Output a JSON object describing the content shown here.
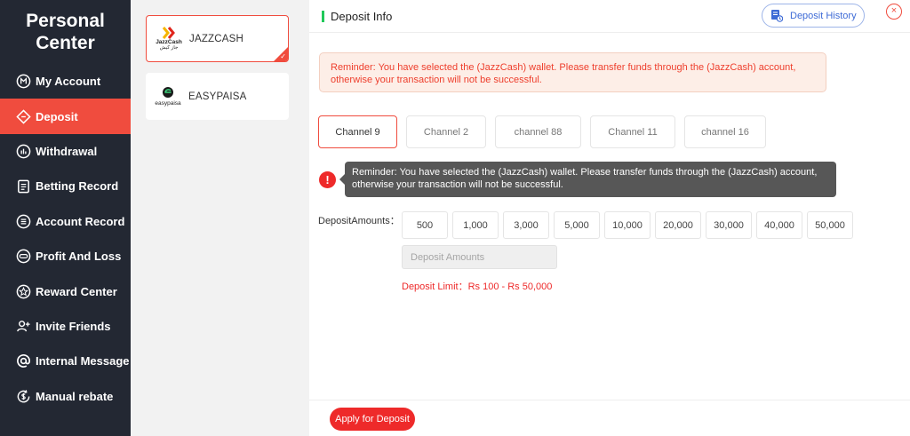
{
  "sidebar": {
    "title_line1": "Personal",
    "title_line2": "Center",
    "items": [
      {
        "label": "My Account",
        "icon": "account-circle-icon",
        "active": false
      },
      {
        "label": "Deposit",
        "icon": "ticket-icon",
        "active": true
      },
      {
        "label": "Withdrawal",
        "icon": "bar-chart-circle-icon",
        "active": false
      },
      {
        "label": "Betting Record",
        "icon": "clipboard-icon",
        "active": false
      },
      {
        "label": "Account Record",
        "icon": "list-document-icon",
        "active": false
      },
      {
        "label": "Profit And Loss",
        "icon": "dots-circle-icon",
        "active": false
      },
      {
        "label": "Reward Center",
        "icon": "star-badge-icon",
        "active": false
      },
      {
        "label": "Invite Friends",
        "icon": "add-user-icon",
        "active": false
      },
      {
        "label": "Internal Message",
        "icon": "at-sign-icon",
        "active": false
      },
      {
        "label": "Manual rebate",
        "icon": "dollar-refresh-icon",
        "active": false
      }
    ],
    "active_color": "#f04c3e"
  },
  "wallets": [
    {
      "name": "JAZZCASH",
      "logo_text": "JazzCash",
      "logo_subtext": "جاز کیش",
      "selected": true
    },
    {
      "name": "EASYPAISA",
      "logo_text": "easypaisa",
      "selected": false
    }
  ],
  "header": {
    "title": "Deposit Info",
    "history_label": "Deposit History",
    "close_glyph": "×"
  },
  "reminder": "Reminder: You have selected the (JazzCash) wallet. Please transfer funds through the (JazzCash) account, otherwise your transaction will not be successful.",
  "channels": [
    {
      "label": "Channel 9",
      "active": true
    },
    {
      "label": "Channel 2",
      "active": false
    },
    {
      "label": "channel  88",
      "active": false
    },
    {
      "label": "Channel 11",
      "active": false
    },
    {
      "label": "channel 16",
      "active": false
    }
  ],
  "tooltip": {
    "icon_glyph": "!",
    "line1": "Reminder: You have selected the (JazzCash) wallet. Please transfer funds through the (JazzCash) account,",
    "line2": "otherwise your transaction will not be successful."
  },
  "amounts": {
    "label": "DepositAmounts：",
    "options": [
      "500",
      "1,000",
      "3,000",
      "5,000",
      "10,000",
      "20,000",
      "30,000",
      "40,000",
      "50,000"
    ],
    "placeholder": "Deposit Amounts",
    "limit": "Deposit Limit：Rs  100  - Rs  50,000"
  },
  "footer": {
    "apply_label": "Apply for Deposit"
  },
  "colors": {
    "accent": "#f04c3e",
    "danger": "#ee2a2a",
    "success_bar": "#21c95a",
    "link_blue": "#3e6bd6"
  }
}
